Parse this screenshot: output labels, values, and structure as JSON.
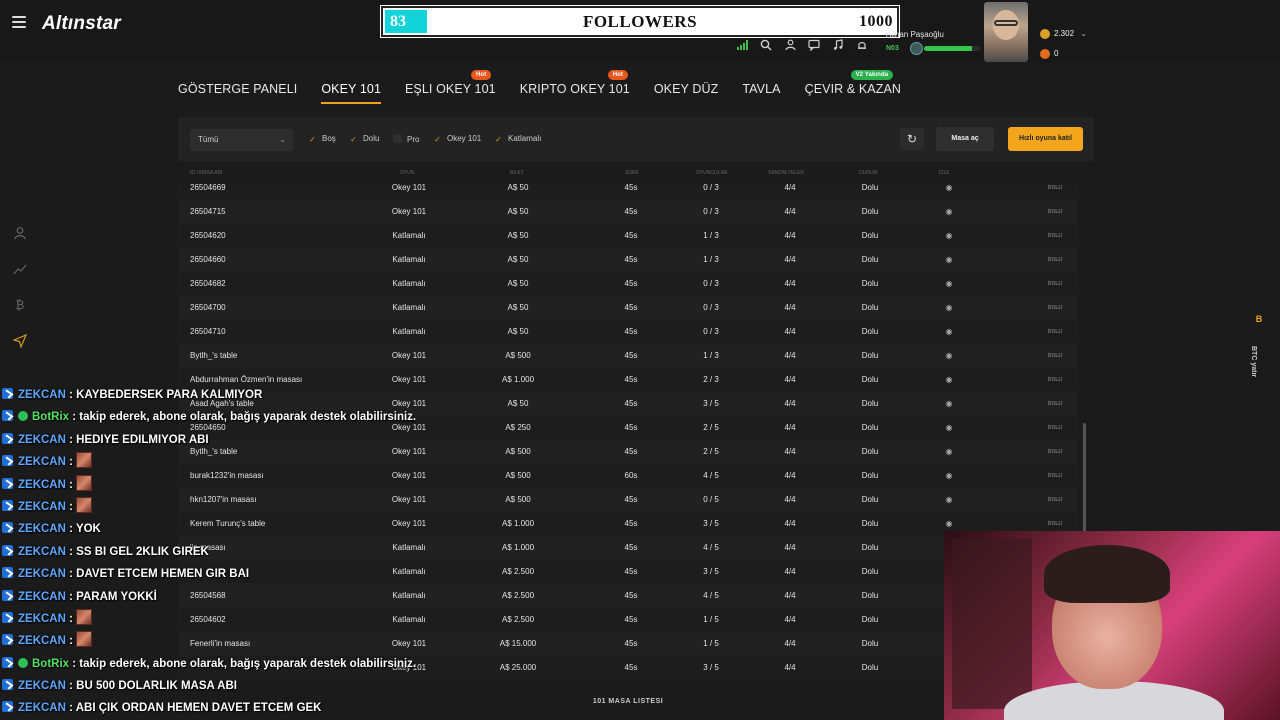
{
  "app": {
    "logo": "Altınstar"
  },
  "followers_widget": {
    "count": "83",
    "label": "FOLLOWERS",
    "goal": "1000",
    "accent": "#12d4d8"
  },
  "user": {
    "name": "Alihan Paşaoğlu",
    "level": "N03",
    "xp_fraction": 0.85
  },
  "wallet": {
    "coins": "2.302",
    "gems": "0"
  },
  "nav": [
    {
      "label": "GÖSTERGE PANELI",
      "tag": ""
    },
    {
      "label": "OKEY 101",
      "tag": "",
      "active": true
    },
    {
      "label": "EŞLI OKEY 101",
      "tag": "Hot"
    },
    {
      "label": "KRIPTO OKEY 101",
      "tag": "Hot"
    },
    {
      "label": "OKEY DÜZ",
      "tag": ""
    },
    {
      "label": "TAVLA",
      "tag": ""
    },
    {
      "label": "ÇEVIR & KAZAN",
      "tag": "V2 Yakında"
    }
  ],
  "filters": {
    "select_value": "Tümü",
    "checks": [
      {
        "label": "Boş",
        "checked": true
      },
      {
        "label": "Dolu",
        "checked": true
      },
      {
        "label": "Pro",
        "checked": false
      },
      {
        "label": "Okey 101",
        "checked": true
      },
      {
        "label": "Katlamalı",
        "checked": true
      }
    ],
    "create_table": "Masa aç",
    "quick_join": "Hızlı oyuna katıl"
  },
  "table": {
    "headers": [
      "ID / MASA ADI",
      "OYUN",
      "BILET",
      "SÜRE",
      "OYUNCULAR",
      "SANDALYELER",
      "DURUM",
      "İZLE",
      ""
    ],
    "rows": [
      [
        "26504669",
        "Okey 101",
        "A$ 50",
        "45s",
        "0 / 3",
        "4/4",
        "Dolu",
        "DOLU"
      ],
      [
        "26504715",
        "Okey 101",
        "A$ 50",
        "45s",
        "0 / 3",
        "4/4",
        "Dolu",
        "DOLU"
      ],
      [
        "26504620",
        "Katlamalı",
        "A$ 50",
        "45s",
        "1 / 3",
        "4/4",
        "Dolu",
        "DOLU"
      ],
      [
        "26504660",
        "Katlamalı",
        "A$ 50",
        "45s",
        "1 / 3",
        "4/4",
        "Dolu",
        "DOLU"
      ],
      [
        "26504682",
        "Katlamalı",
        "A$ 50",
        "45s",
        "0 / 3",
        "4/4",
        "Dolu",
        "DOLU"
      ],
      [
        "26504700",
        "Katlamalı",
        "A$ 50",
        "45s",
        "0 / 3",
        "4/4",
        "Dolu",
        "DOLU"
      ],
      [
        "26504710",
        "Katlamalı",
        "A$ 50",
        "45s",
        "0 / 3",
        "4/4",
        "Dolu",
        "DOLU"
      ],
      [
        "Bytlh_'s table",
        "Okey 101",
        "A$ 500",
        "45s",
        "1 / 3",
        "4/4",
        "Dolu",
        "DOLU"
      ],
      [
        "Abdurrahman Özmen'in masası",
        "Okey 101",
        "A$ 1.000",
        "45s",
        "2 / 3",
        "4/4",
        "Dolu",
        "DOLU"
      ],
      [
        "Asad Agah's table",
        "Okey 101",
        "A$ 50",
        "45s",
        "3 / 5",
        "4/4",
        "Dolu",
        "DOLU"
      ],
      [
        "26504650",
        "Okey 101",
        "A$ 250",
        "45s",
        "2 / 5",
        "4/4",
        "Dolu",
        "DOLU"
      ],
      [
        "Bytlh_'s table",
        "Okey 101",
        "A$ 500",
        "45s",
        "2 / 5",
        "4/4",
        "Dolu",
        "DOLU"
      ],
      [
        "burak1232'in masası",
        "Okey 101",
        "A$ 500",
        "60s",
        "4 / 5",
        "4/4",
        "Dolu",
        "DOLU"
      ],
      [
        "hkn1207'in masası",
        "Okey 101",
        "A$ 500",
        "45s",
        "0 / 5",
        "4/4",
        "Dolu",
        "DOLU"
      ],
      [
        "Kerem Turunç's table",
        "Okey 101",
        "A$ 1.000",
        "45s",
        "3 / 5",
        "4/4",
        "Dolu",
        "DOLU"
      ],
      [
        "'in masası",
        "Katlamalı",
        "A$ 1.000",
        "45s",
        "4 / 5",
        "4/4",
        "Dolu",
        "DOLU"
      ],
      [
        "",
        "Katlamalı",
        "A$ 2.500",
        "45s",
        "3 / 5",
        "4/4",
        "Dolu",
        "DOLU"
      ],
      [
        "26504568",
        "Katlamalı",
        "A$ 2.500",
        "45s",
        "4 / 5",
        "4/4",
        "Dolu",
        "DOLU"
      ],
      [
        "26504602",
        "Katlamalı",
        "A$ 2.500",
        "45s",
        "1 / 5",
        "4/4",
        "Dolu",
        "DOLU"
      ],
      [
        "Fenerli'in masası",
        "Okey 101",
        "A$ 15.000",
        "45s",
        "1 / 5",
        "4/4",
        "Dolu",
        "DOLU"
      ],
      [
        "",
        "Okey 101",
        "A$ 25.000",
        "45s",
        "3 / 5",
        "4/4",
        "Dolu",
        "DOLU"
      ]
    ],
    "footer": "101 MASA LISTESI"
  },
  "btc_tab": {
    "symbol": "B",
    "label": "BTC yatır"
  },
  "chat": [
    {
      "user": "ZEKCAN",
      "badge": "tw",
      "text": "KAYBEDERSEK PARA KALMIYOR",
      "emote": false
    },
    {
      "user": "BotRix",
      "badge": "bot",
      "text": "takip ederek, abone olarak, bağış yaparak destek olabilirsiniz.",
      "emote": false
    },
    {
      "user": "ZEKCAN",
      "badge": "tw",
      "text": "HEDIYE EDILMIYOR ABI",
      "emote": false
    },
    {
      "user": "ZEKCAN",
      "badge": "tw",
      "text": "",
      "emote": true
    },
    {
      "user": "ZEKCAN",
      "badge": "tw",
      "text": "",
      "emote": true
    },
    {
      "user": "ZEKCAN",
      "badge": "tw",
      "text": "",
      "emote": true
    },
    {
      "user": "ZEKCAN",
      "badge": "tw",
      "text": "YOK",
      "emote": false
    },
    {
      "user": "ZEKCAN",
      "badge": "tw",
      "text": "SS BI GEL 2KLIK GIREK",
      "emote": false
    },
    {
      "user": "ZEKCAN",
      "badge": "tw",
      "text": "DAVET ETCEM HEMEN GIR BAI",
      "emote": false
    },
    {
      "user": "ZEKCAN",
      "badge": "tw",
      "text": "PARAM YOKKİ",
      "emote": false
    },
    {
      "user": "ZEKCAN",
      "badge": "tw",
      "text": "",
      "emote": true
    },
    {
      "user": "ZEKCAN",
      "badge": "tw",
      "text": "",
      "emote": true
    },
    {
      "user": "BotRix",
      "badge": "bot",
      "text": "takip ederek, abone olarak, bağış yaparak destek olabilirsiniz.",
      "emote": false
    },
    {
      "user": "ZEKCAN",
      "badge": "tw",
      "text": "BU 500 DOLARLIK MASA ABI",
      "emote": false
    },
    {
      "user": "ZEKCAN",
      "badge": "tw",
      "text": "ABI ÇIK ORDAN HEMEN DAVET ETCEM GEK",
      "emote": false
    }
  ]
}
